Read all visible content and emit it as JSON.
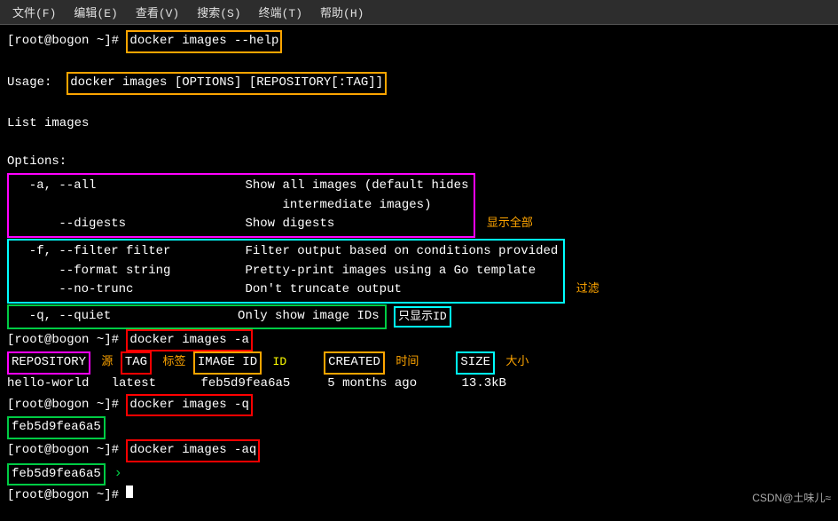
{
  "menubar": {
    "items": [
      "文件(F)",
      "编辑(E)",
      "查看(V)",
      "搜索(S)",
      "终端(T)",
      "帮助(H)"
    ]
  },
  "terminal": {
    "lines": [
      {
        "type": "prompt_cmd",
        "prompt": "[root@bogon ~]# ",
        "cmd_box": "docker images --help"
      },
      {
        "type": "blank"
      },
      {
        "type": "text_box",
        "label": "Usage:",
        "cmd_box": "docker images [OPTIONS] [REPOSITORY[:TAG]]"
      },
      {
        "type": "blank"
      },
      {
        "type": "plain",
        "text": "List images"
      },
      {
        "type": "blank"
      },
      {
        "type": "plain",
        "text": "Options:"
      },
      {
        "type": "options_magenta_start"
      },
      {
        "type": "option_row",
        "opt": "  -a, --all",
        "pad": "                    ",
        "desc": "Show all images (default hides",
        "label": "显示全部",
        "label_color": "orange"
      },
      {
        "type": "option_row2",
        "pad": "                                    ",
        "desc": "intermediate images)"
      },
      {
        "type": "option_row",
        "opt": "      --digests",
        "pad": "                ",
        "desc": "Show digests"
      },
      {
        "type": "options_magenta_end"
      },
      {
        "type": "options_cyan_start"
      },
      {
        "type": "option_row",
        "opt": "  -f, --filter filter",
        "pad": "          ",
        "desc": "Filter output based on conditions provided"
      },
      {
        "type": "option_row",
        "opt": "      --format string",
        "pad": "          ",
        "desc": "Pretty-print images using a Go template"
      },
      {
        "type": "option_row",
        "opt": "      --no-trunc",
        "pad": "               ",
        "desc": "Don't truncate output",
        "label": "过滤",
        "label_color": "orange"
      },
      {
        "type": "options_cyan_end"
      },
      {
        "type": "options_green_start"
      },
      {
        "type": "option_row_green",
        "opt": "  -q, --quiet",
        "pad": "                  ",
        "desc": "Only show image IDs",
        "id_label": "只显示ID"
      },
      {
        "type": "options_green_end"
      },
      {
        "type": "prompt_cmd",
        "prompt": "[root@bogon ~]# ",
        "cmd_box": "docker images -a"
      },
      {
        "type": "table_header"
      },
      {
        "type": "table_row",
        "repo": "hello-world",
        "tag": "latest",
        "id": "feb5d9fea6a5",
        "created": "5 months ago",
        "size": "13.3kB"
      },
      {
        "type": "prompt_cmd",
        "prompt": "[root@bogon ~]# ",
        "cmd_box": "docker images -q"
      },
      {
        "type": "id_green",
        "val": "feb5d9fea6a5"
      },
      {
        "type": "prompt_cmd",
        "prompt": "[root@bogon ~]# ",
        "cmd_box": "docker images -aq"
      },
      {
        "type": "id_green2",
        "val": "feb5d9fea6a5"
      },
      {
        "type": "prompt_end",
        "prompt": "[root@bogon ~]# "
      }
    ],
    "watermark": "CSDN@土味儿≈"
  }
}
